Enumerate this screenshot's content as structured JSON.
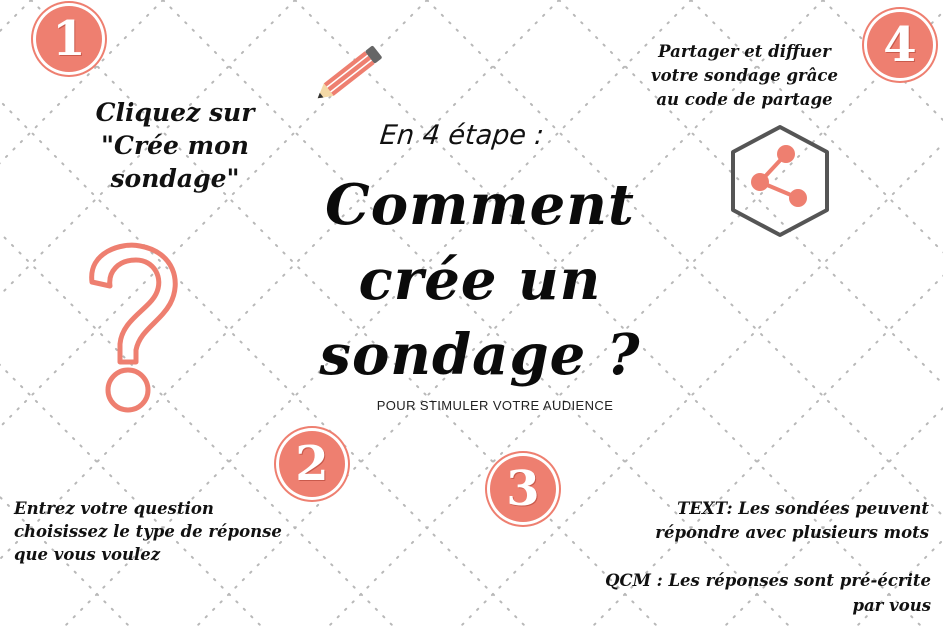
{
  "colors": {
    "accent": "#ee7f70",
    "text": "#111111",
    "dots": "#b8b8b8"
  },
  "subtitle": "En 4 étape :",
  "title": [
    "Comment",
    "crée un",
    "sondage ?"
  ],
  "tagline": "POUR STIMULER VOTRE AUDIENCE",
  "steps": {
    "one": {
      "number": "1",
      "lines": [
        "Cliquez sur",
        "\"Crée mon",
        "sondage\""
      ]
    },
    "two": {
      "number": "2",
      "lines": [
        "Entrez votre question",
        "choisissez le type de réponse",
        "que vous voulez"
      ]
    },
    "three": {
      "number": "3",
      "text_keyword": "TEXT",
      "text_lines": [
        ": Les sondées peuvent",
        "répondre avec plusieurs mots"
      ],
      "qcm_keyword": "QCM",
      "qcm_lines": [
        " : Les réponses sont pré-écrite",
        "par vous"
      ]
    },
    "four": {
      "number": "4",
      "lines": [
        "Partager et diffuer",
        "votre sondage grâce",
        "au code de partage"
      ]
    }
  },
  "icons": {
    "pencil": "pencil-icon",
    "question": "question-mark-icon",
    "share": "share-hexagon-icon"
  }
}
